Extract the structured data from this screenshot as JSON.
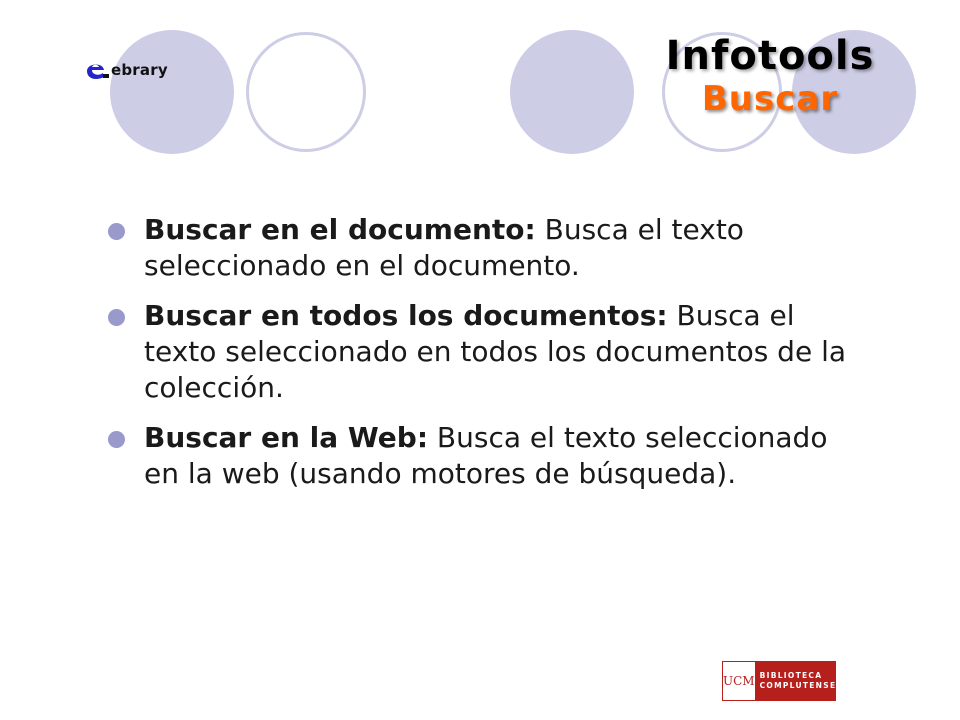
{
  "header": {
    "logo_text": "ebrary",
    "title": "Infotools",
    "subtitle": "Buscar"
  },
  "bullets": [
    {
      "term": "Buscar en el documento:",
      "text": " Busca el texto seleccionado en el documento."
    },
    {
      "term": "Buscar en todos los documentos:",
      "text": " Busca el texto seleccionado en todos los documentos de la colección."
    },
    {
      "term": "Buscar en la Web:",
      "text": " Busca el texto seleccionado en la web (usando motores de búsqueda)."
    }
  ],
  "footer": {
    "ucm": "UCM",
    "line1": "BIBLIOTECA",
    "line2": "COMPLUTENSE"
  },
  "colors": {
    "circle": "#cdcde6",
    "bullet": "#9999cc",
    "subtitle": "#ff6600",
    "brand_red": "#b6201c",
    "ebrary_blue": "#2424c8"
  }
}
